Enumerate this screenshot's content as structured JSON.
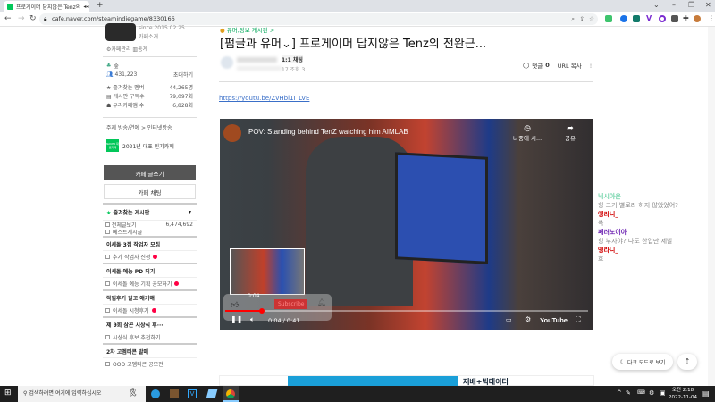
{
  "browser": {
    "tab_title": "프로게이머 답지않은 Tenz의",
    "url": "cafe.naver.com/steamindiegame/8330166",
    "new_tab": "+"
  },
  "sidebar": {
    "since": "since 2015.02.25.",
    "cafe_intro": "카페소개",
    "manage": "카페관리",
    "stats": "통계",
    "level": "숲",
    "members": "431,223",
    "invite": "초대하기",
    "stats_rows": [
      {
        "label": "즐겨찾는 멤버",
        "value": "44,265명"
      },
      {
        "label": "게시판 구독수",
        "value": "79,097회"
      },
      {
        "label": "우리카페앱 수",
        "value": "6,828회"
      }
    ],
    "topic": "주제 방송/연예 > 인터넷방송",
    "badge": "NAVER 대표카페",
    "badge_text": "2021년 대표 인기카페",
    "write_button": "카페 글쓰기",
    "chat_button": "카페 채팅",
    "favorites": "즐겨찾는 게시판",
    "all_posts": "전체글보기",
    "all_count": "6,474,692",
    "best": "베스트게시글",
    "sections": [
      {
        "title": "이세돌 3집 작업자 모집",
        "items": [
          "추가 작업자 신청"
        ]
      },
      {
        "title": "이세돌 예능 PD 되기",
        "items": [
          "이세돌 예능 기획 공모하기"
        ]
      },
      {
        "title": "작업후기 알고 얘기해",
        "items": [
          "이세돌 시청후기"
        ]
      },
      {
        "title": "제 9회 삼곤 시상식 후···",
        "items": [
          "시상식 후보 추천하기"
        ]
      },
      {
        "title": "2차 고멤티콘 발매",
        "items": [
          "OOO 고멤티콘 공모전"
        ]
      }
    ]
  },
  "article": {
    "board": "유머,정보 게시판 >",
    "title": "[펌글과 유머⌄] 프로게이머 답지않은 Tenz의 전완근...",
    "chat_label": "1:1 채팅",
    "meta": "17 조회 3",
    "comments": "댓글",
    "comment_count": "0",
    "url_copy": "URL 복사",
    "link": "https://youtu.be/ZvHbi1I_LVE"
  },
  "video": {
    "title": "POV: Standing behind TenZ watching him AIMLAB",
    "watch_later": "나중에 시...",
    "share": "공유",
    "hover_time": "0:04",
    "subscribe": "Subscribe",
    "time": "0:04 / 0:41",
    "progress": 0.1,
    "logo": "YouTube"
  },
  "chat": {
    "messages": [
      {
        "user": "닉시아운",
        "text": "힝 그거 별로라 하지 않았었어?",
        "color": "#6fd3a8"
      },
      {
        "user": "엥라니_",
        "text": "쏙",
        "color": "#d00000"
      },
      {
        "user": "패러노이아",
        "text": "힝 부자야? 나도 한입만 제발",
        "color": "#6a1fb0"
      },
      {
        "user": "엥라니_",
        "text": "흐",
        "color": "#d00000"
      }
    ],
    "dark_mode": "다크 모드로 보기"
  },
  "banner": {
    "text": "재배+빅데이터"
  },
  "taskbar": {
    "search": "검색하려면 여기에 입력하십시오",
    "time": "오전 2:18",
    "date": "2022-11-04"
  }
}
